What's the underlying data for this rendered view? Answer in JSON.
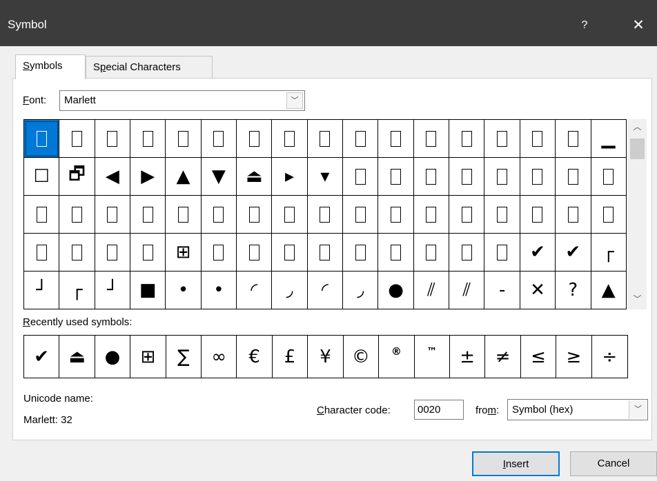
{
  "dialog": {
    "title": "Symbol",
    "help_glyph": "?",
    "close_glyph": "✕"
  },
  "tabs": [
    {
      "label": "Symbols",
      "accel": "S",
      "rest": "ymbols",
      "active": true
    },
    {
      "label": "Special Characters",
      "pre": "S",
      "accel": "p",
      "rest": "ecial Characters",
      "active": false
    }
  ],
  "font": {
    "label_accel": "F",
    "label_rest": "ont:",
    "value": "Marlett"
  },
  "grid": {
    "rows": [
      [
        "□",
        "□",
        "□",
        "□",
        "□",
        "□",
        "□",
        "□",
        "□",
        "□",
        "□",
        "□",
        "□",
        "□",
        "□",
        "□",
        "▁"
      ],
      [
        "☐",
        "🗗",
        "◀",
        "▶",
        "▲",
        "▼",
        "⏏",
        "▸",
        "▾",
        "□",
        "□",
        "□",
        "□",
        "□",
        "□",
        "□",
        "□"
      ],
      [
        "□",
        "□",
        "□",
        "□",
        "□",
        "□",
        "□",
        "□",
        "□",
        "□",
        "□",
        "□",
        "□",
        "□",
        "□",
        "□",
        "□"
      ],
      [
        "□",
        "□",
        "□",
        "□",
        "⊞",
        "□",
        "□",
        "□",
        "□",
        "□",
        "□",
        "□",
        "□",
        "□",
        "✔",
        "✔",
        "┌"
      ],
      [
        "┘",
        "┌",
        "┘",
        "■",
        "•",
        "•",
        "◜",
        "◞",
        "◜",
        "◞",
        "●",
        "⫽",
        "⫽",
        "-",
        "✕",
        "?",
        "▲"
      ]
    ],
    "selected_index": 0
  },
  "recent": {
    "label_accel": "R",
    "label_rest": "ecently used symbols:",
    "symbols": [
      "✔",
      "⏏",
      "●",
      "⊞",
      "∑",
      "∞",
      "€",
      "£",
      "¥",
      "©",
      "®",
      "™",
      "±",
      "≠",
      "≤",
      "≥",
      "÷"
    ]
  },
  "unicode": {
    "label": "Unicode name:",
    "value": "Marlett: 32"
  },
  "char_code": {
    "label_accel": "C",
    "label_rest": "haracter code:",
    "value": "0020"
  },
  "from": {
    "label_pre": "fro",
    "label_accel": "m",
    "label_rest": ":",
    "value": "Symbol (hex)"
  },
  "buttons": {
    "insert_accel": "I",
    "insert_rest": "nsert",
    "cancel": "Cancel"
  },
  "colors": {
    "titlebar": "#3c3c3c",
    "selection": "#0078d7",
    "default_button_border": "#0078d7"
  }
}
